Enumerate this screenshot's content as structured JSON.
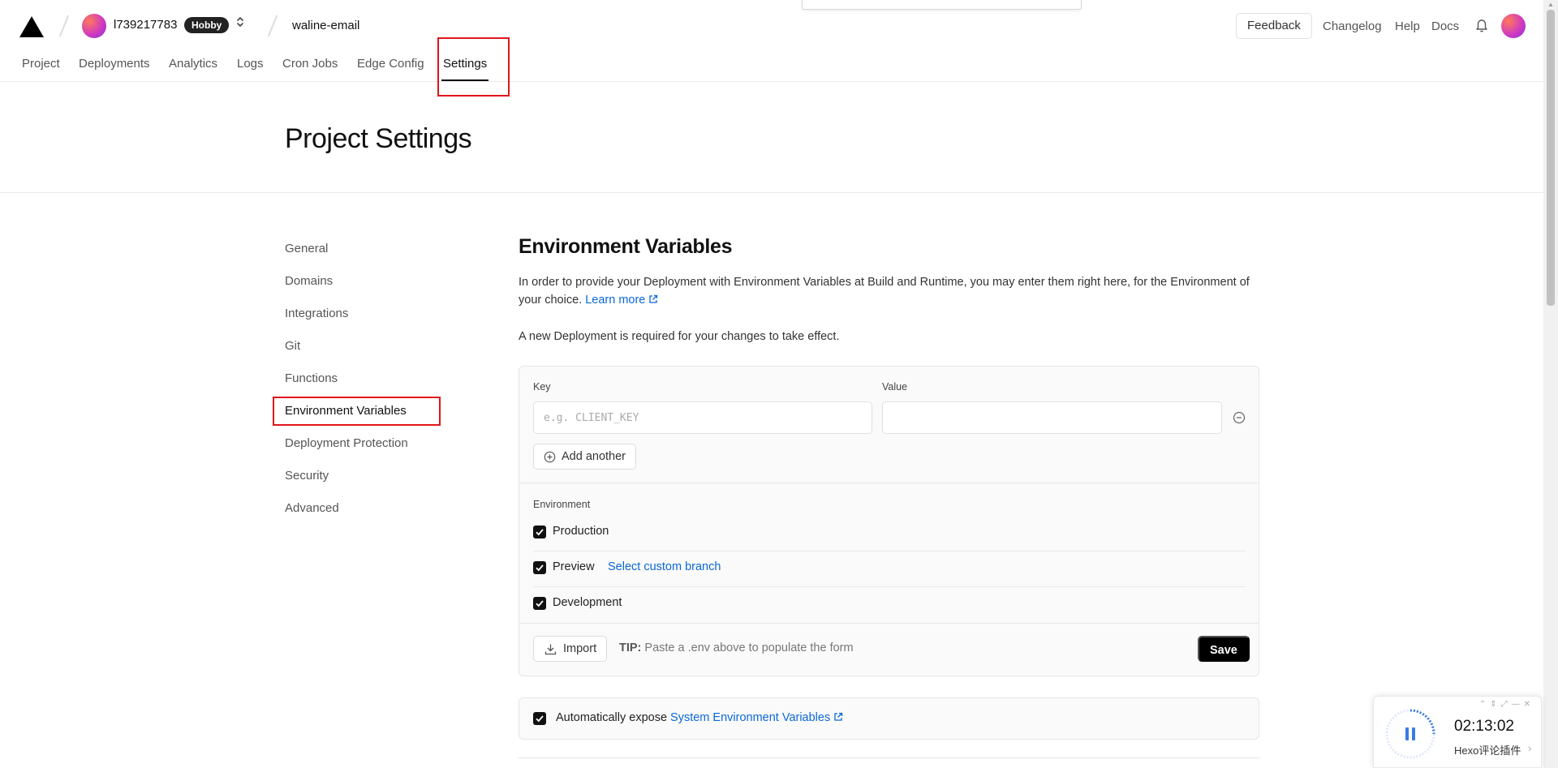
{
  "header": {
    "team_name": "l739217783",
    "plan_badge": "Hobby",
    "project_name": "waline-email",
    "feedback_label": "Feedback",
    "links": [
      "Changelog",
      "Help",
      "Docs"
    ]
  },
  "tabs": [
    "Project",
    "Deployments",
    "Analytics",
    "Logs",
    "Cron Jobs",
    "Edge Config",
    "Settings"
  ],
  "page": {
    "title": "Project Settings"
  },
  "sidebar": {
    "items": [
      "General",
      "Domains",
      "Integrations",
      "Git",
      "Functions",
      "Environment Variables",
      "Deployment Protection",
      "Security",
      "Advanced"
    ]
  },
  "env": {
    "title": "Environment Variables",
    "description": "In order to provide your Deployment with Environment Variables at Build and Runtime, you may enter them right here, for the Environment of your choice.",
    "learn_more": "Learn more",
    "notice": "A new Deployment is required for your changes to take effect.",
    "key_label": "Key",
    "key_placeholder": "e.g. CLIENT_KEY",
    "value_label": "Value",
    "value_value": "",
    "add_another": "Add another",
    "environment_label": "Environment",
    "environments": [
      {
        "label": "Production",
        "checked": true
      },
      {
        "label": "Preview",
        "checked": true
      },
      {
        "label": "Development",
        "checked": true
      }
    ],
    "custom_branch_link": "Select custom branch",
    "import_label": "Import",
    "tip_label": "TIP:",
    "tip_text": "Paste a .env above to populate the form",
    "save_label": "Save",
    "expose_text": "Automatically expose",
    "expose_link": "System Environment Variables"
  },
  "widget": {
    "time": "02:13:02",
    "label": "Hexo评论插件"
  },
  "colors": {
    "link": "#0a68d8",
    "highlight_box": "#e0151c",
    "primary_button": "#000000"
  }
}
